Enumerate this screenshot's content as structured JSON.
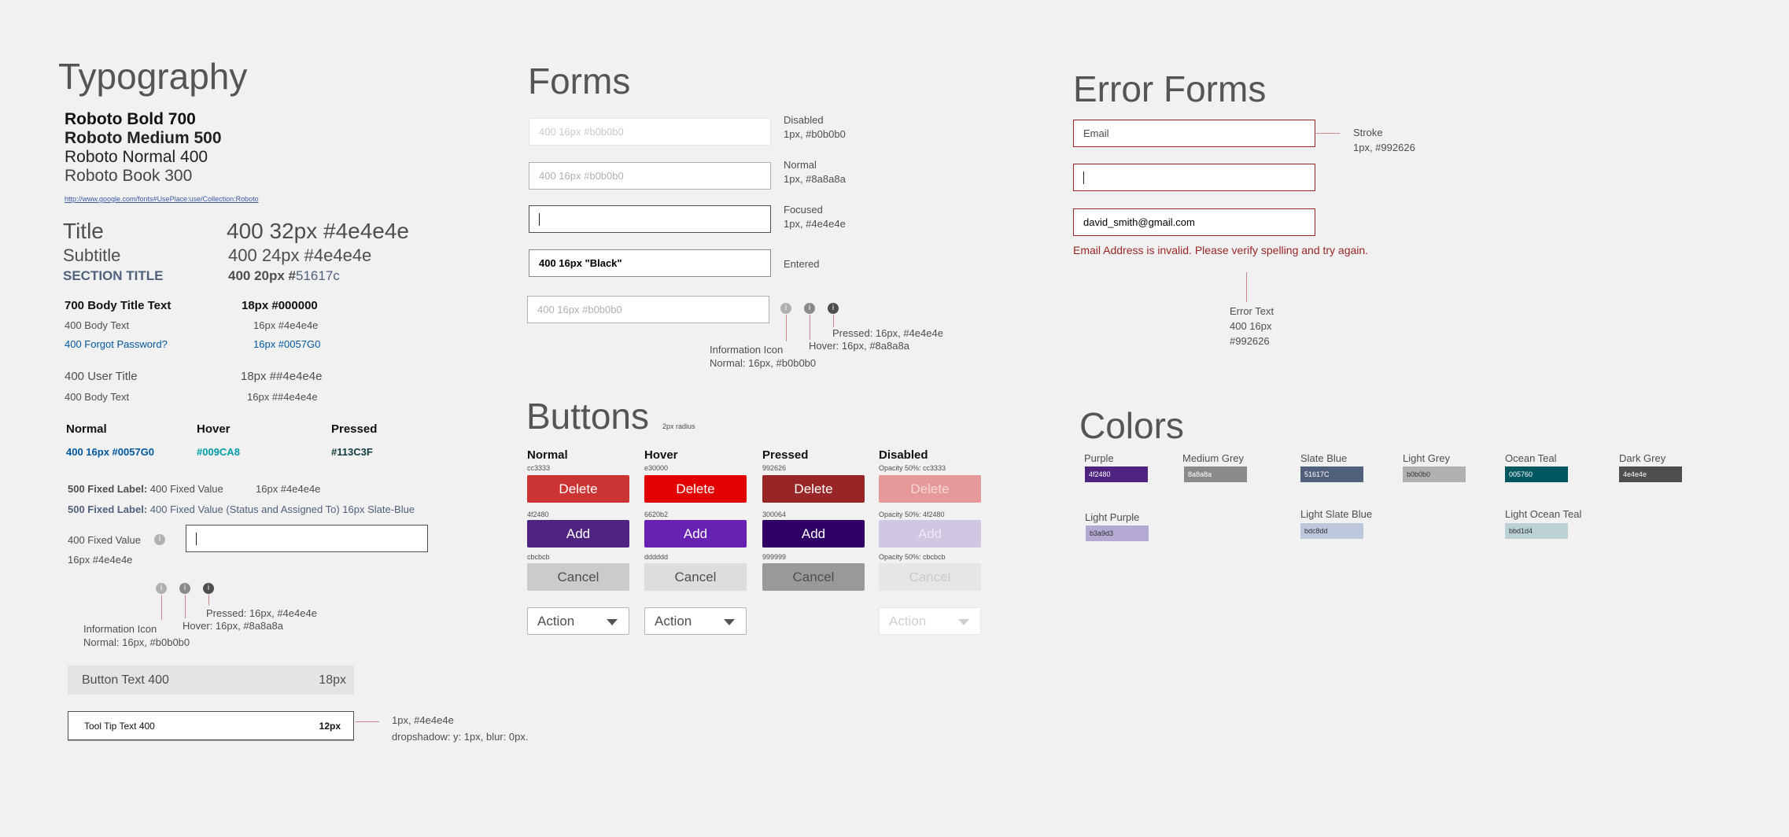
{
  "typography": {
    "heading": "Typography",
    "weights": [
      "Roboto Bold 700",
      "Roboto Medium 500",
      "Roboto Normal 400",
      "Roboto Book 300"
    ],
    "link": "http://www.google.com/fonts#UsePlace:use/Collection:Roboto",
    "title": "Title",
    "title_spec": "400 32px #4e4e4e",
    "subtitle": "Subtitle",
    "subtitle_spec": "400 24px #4e4e4e",
    "section_title": "SECTION TITLE",
    "section_spec_prefix": "400 20px #",
    "section_spec_color": "51617c",
    "body_title": "700 Body Title Text",
    "body_title_spec": "18px #000000",
    "body_text": "400 Body Text",
    "body_text_spec": "16px #4e4e4e",
    "forgot": "400 Forgot Password?",
    "forgot_spec": "16px #0057G0",
    "user_title": "400 User Title",
    "user_title_spec": "18px ##4e4e4e",
    "body_text2": "400 Body Text",
    "body_text2_spec": "16px ##4e4e4e",
    "state_normal": "Normal",
    "state_hover": "Hover",
    "state_pressed": "Pressed",
    "state_normal_val": "400 16px #0057G0",
    "state_hover_val": "#009CA8",
    "state_pressed_val": "#113C3F",
    "fixed1_label": "500 Fixed Label:",
    "fixed1_value": "400 Fixed Value",
    "fixed1_spec": "16px #4e4e4e",
    "fixed2_label": "500 Fixed Label:",
    "fixed2_value": "400 Fixed Value (Status and Assigned To) 16px Slate-Blue",
    "fixed_value": "400 Fixed Value",
    "fixed_value_spec": "16px #4e4e4e",
    "info_icon_label": "Information Icon",
    "info_normal": "Normal: 16px, #b0b0b0",
    "info_hover": "Hover: 16px, #8a8a8a",
    "info_pressed": "Pressed: 16px, #4e4e4e",
    "button_text": "Button Text 400",
    "button_text_size": "18px",
    "tooltip_text": "Tool Tip Text 400",
    "tooltip_size": "12px",
    "tooltip_note1": "1px, #4e4e4e",
    "tooltip_note2": "dropshadow: y: 1px, blur: 0px."
  },
  "forms": {
    "heading": "Forms",
    "disabled_placeholder": "400 16px #b0b0b0",
    "disabled_label": "Disabled",
    "disabled_spec": "1px, #b0b0b0",
    "normal_placeholder": "400 16px #b0b0b0",
    "normal_label": "Normal",
    "normal_spec": "1px, #8a8a8a",
    "focused_label": "Focused",
    "focused_spec": "1px, #4e4e4e",
    "entered_value": "400 16px \"Black\"",
    "entered_label": "Entered",
    "icon_placeholder": "400 16px #b0b0b0",
    "info_icon_label": "Information Icon",
    "info_normal": "Normal: 16px, #b0b0b0",
    "info_hover": "Hover: 16px, #8a8a8a",
    "info_pressed": "Pressed: 16px, #4e4e4e"
  },
  "buttons": {
    "heading": "Buttons",
    "radius_note": "2px radius",
    "col_normal": "Normal",
    "col_hover": "Hover",
    "col_pressed": "Pressed",
    "col_disabled": "Disabled",
    "delete": "Delete",
    "add": "Add",
    "cancel": "Cancel",
    "action": "Action",
    "hex_delete": [
      "cc3333",
      "e30000",
      "992626",
      "Opacity 50%: cc3333"
    ],
    "hex_add": [
      "4f2480",
      "6620b2",
      "300064",
      "Opacity 50%: 4f2480"
    ],
    "hex_cancel": [
      "cbcbcb",
      "dddddd",
      "999999",
      "Opacity 50%: cbcbcb"
    ],
    "colors": {
      "delete": [
        "#cc3333",
        "#e30000",
        "#992626",
        "#e69999"
      ],
      "add": [
        "#4f2480",
        "#6620b2",
        "#300064",
        "#d0c7e3"
      ],
      "cancel": [
        "#cbcbcb",
        "#dddddd",
        "#999999",
        "#e6e6e6"
      ]
    }
  },
  "error_forms": {
    "heading": "Error Forms",
    "email_placeholder": "Email",
    "stroke_label": "Stroke",
    "stroke_spec": "1px, #992626",
    "entered_value": "david_smith@gmail.com",
    "error_message": "Email Address is invalid. Please verify spelling and try again.",
    "error_text_label": "Error Text",
    "error_text_spec1": "400 16px",
    "error_text_spec2": "#992626"
  },
  "colors": {
    "heading": "Colors",
    "swatches": [
      {
        "name": "Purple",
        "hex": "4f2480",
        "color": "#4f2480"
      },
      {
        "name": "Medium Grey",
        "hex": "8a8a8a",
        "color": "#8a8a8a"
      },
      {
        "name": "Slate Blue",
        "hex": "51617C",
        "color": "#51617c"
      },
      {
        "name": "Light Grey",
        "hex": "b0b0b0",
        "color": "#b0b0b0"
      },
      {
        "name": "Ocean Teal",
        "hex": "005760",
        "color": "#005760"
      },
      {
        "name": "Dark Grey",
        "hex": "4e4e4e",
        "color": "#4e4e4e"
      },
      {
        "name": "Light Purple",
        "hex": "b3a9d3",
        "color": "#b3a9d3"
      },
      {
        "name": "Light Slate Blue",
        "hex": "bdc8dd",
        "color": "#bdc8dd"
      },
      {
        "name": "Light Ocean Teal",
        "hex": "bbd1d4",
        "color": "#bbd1d4"
      }
    ]
  }
}
